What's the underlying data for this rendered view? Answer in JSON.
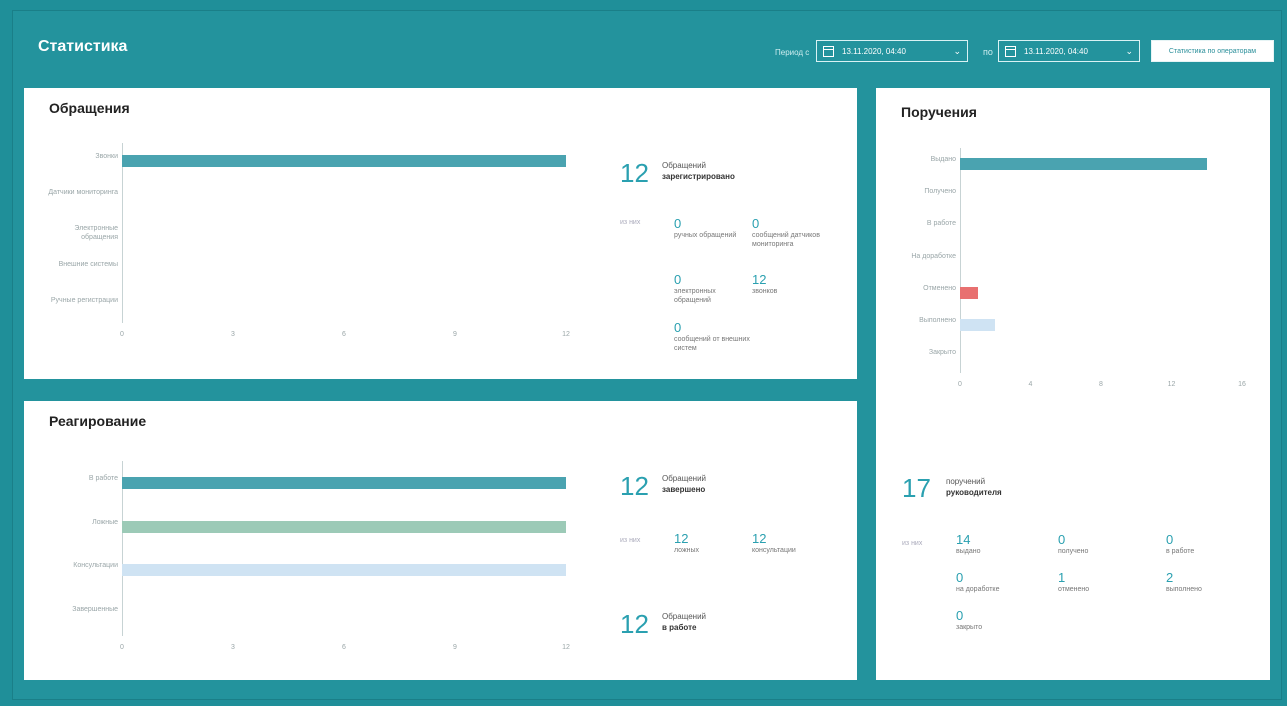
{
  "header": {
    "title": "Статистика",
    "period_label": "Период с",
    "date_from": "13.11.2020, 04:40",
    "date_to": "13.11.2020, 04:40",
    "separator": "по",
    "button_label": "Статистика по операторам"
  },
  "appeals": {
    "title": "Обращения",
    "chart_data": {
      "type": "bar",
      "orientation": "horizontal",
      "categories": [
        "Звонки",
        "Датчики мониторинга",
        "Электронные обращения",
        "Внешние системы",
        "Ручные регистрации"
      ],
      "values": [
        12,
        0,
        0,
        0,
        0
      ],
      "xticks": [
        "0",
        "3",
        "6",
        "9",
        "12"
      ],
      "xlim": [
        0,
        12
      ]
    },
    "total": "12",
    "total_caption": "Обращений",
    "total_caption_bold": "зарегистрировано",
    "of_them": "из них",
    "stats": [
      {
        "value": "0",
        "label": "ручных обращений"
      },
      {
        "value": "0",
        "label": "сообщений датчиков мониторинга"
      },
      {
        "value": "0",
        "label": "электронных обращений"
      },
      {
        "value": "12",
        "label": "звонков"
      },
      {
        "value": "0",
        "label": "сообщений от внешних систем"
      }
    ]
  },
  "response": {
    "title": "Реагирование",
    "chart_data": {
      "type": "bar",
      "orientation": "horizontal",
      "categories": [
        "В работе",
        "Ложные",
        "Консультации",
        "Завершенные"
      ],
      "values": [
        12,
        12,
        12,
        0
      ],
      "colors": [
        "#4aa3b0",
        "#9ccab7",
        "#cfe3f3",
        "#1b8394"
      ],
      "xticks": [
        "0",
        "3",
        "6",
        "9",
        "12"
      ],
      "xlim": [
        0,
        12
      ]
    },
    "total1": "12",
    "total1_caption": "Обращений",
    "total1_caption_bold": "завершено",
    "of_them": "из них",
    "stats": [
      {
        "value": "12",
        "label": "ложных"
      },
      {
        "value": "12",
        "label": "консультации"
      }
    ],
    "total2": "12",
    "total2_caption": "Обращений",
    "total2_caption_bold": "в работе"
  },
  "orders": {
    "title": "Поручения",
    "chart_data": {
      "type": "bar",
      "orientation": "horizontal",
      "categories": [
        "Выдано",
        "Получено",
        "В работе",
        "На доработке",
        "Отменено",
        "Выполнено",
        "Закрыто"
      ],
      "values": [
        14,
        0,
        0,
        0,
        1,
        2,
        0
      ],
      "colors": [
        "#4aa3b0",
        "#4aa3b0",
        "#4aa3b0",
        "#4aa3b0",
        "#e87070",
        "#cfe3f3",
        "#4aa3b0"
      ],
      "xticks": [
        "0",
        "4",
        "8",
        "12",
        "16"
      ],
      "xlim": [
        0,
        16
      ]
    },
    "total": "17",
    "total_caption": "поручений",
    "total_caption_bold": "руководителя",
    "of_them": "из них",
    "stats": [
      {
        "value": "14",
        "label": "выдано"
      },
      {
        "value": "0",
        "label": "получено"
      },
      {
        "value": "0",
        "label": "в работе"
      },
      {
        "value": "0",
        "label": "на доработке"
      },
      {
        "value": "1",
        "label": "отменено"
      },
      {
        "value": "2",
        "label": "выполнено"
      },
      {
        "value": "0",
        "label": "закрыто"
      }
    ]
  }
}
